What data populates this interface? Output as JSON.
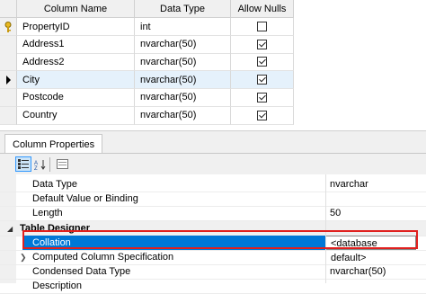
{
  "grid": {
    "headers": [
      "Column Name",
      "Data Type",
      "Allow Nulls"
    ],
    "rows": [
      {
        "name": "PropertyID",
        "type": "int",
        "allow_nulls": false,
        "key": true
      },
      {
        "name": "Address1",
        "type": "nvarchar(50)",
        "allow_nulls": true
      },
      {
        "name": "Address2",
        "type": "nvarchar(50)",
        "allow_nulls": true
      },
      {
        "name": "City",
        "type": "nvarchar(50)",
        "allow_nulls": true,
        "current": true
      },
      {
        "name": "Postcode",
        "type": "nvarchar(50)",
        "allow_nulls": true
      },
      {
        "name": "Country",
        "type": "nvarchar(50)",
        "allow_nulls": true
      }
    ]
  },
  "props": {
    "tab_label": "Column Properties",
    "rows": [
      {
        "label": "Data Type",
        "value": "nvarchar"
      },
      {
        "label": "Default Value or Binding",
        "value": ""
      },
      {
        "label": "Length",
        "value": "50"
      },
      {
        "label": "Table Designer",
        "value": "",
        "category": true
      },
      {
        "label": "Collation",
        "value": "<database default>",
        "selected": true
      },
      {
        "label": "Computed Column Specification",
        "value": "",
        "expandable": true
      },
      {
        "label": "Condensed Data Type",
        "value": "nvarchar(50)"
      },
      {
        "label": "Description",
        "value": ""
      }
    ]
  },
  "icons": {
    "key": "primary-key-icon",
    "row_pointer": "row-pointer-icon",
    "categorized": "categorized-icon",
    "alphabetical": "alphabetical-sort-icon",
    "property_pages": "property-pages-icon"
  },
  "colors": {
    "selection": "#0078d7",
    "highlight_box": "#e0201e",
    "current_row": "#e5f1fb"
  }
}
